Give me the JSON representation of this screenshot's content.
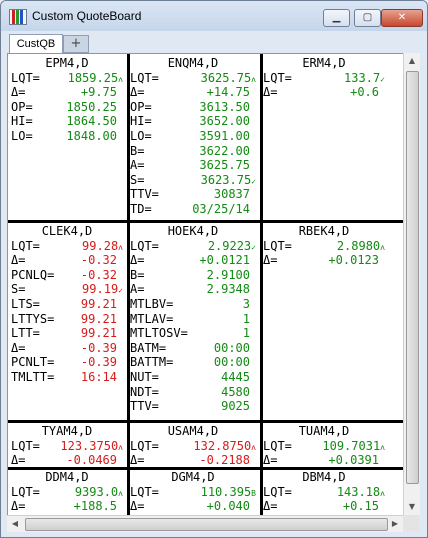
{
  "window": {
    "title": "Custom QuoteBoard",
    "minimize_glyph": "▁",
    "maximize_glyph": "▢",
    "close_glyph": "✕",
    "app_icon_colors": [
      "#cc2222",
      "#2a9a2a",
      "#2255cc"
    ]
  },
  "tabs": [
    {
      "label": "CustQB",
      "active": true
    }
  ],
  "add_tab_label": "+",
  "colors": {
    "up": "#138a13",
    "down": "#d81a1a",
    "grid": "#000000",
    "background": "#ffffff"
  },
  "icons": {
    "scroll_up": "▲",
    "scroll_down": "▼",
    "scroll_left": "◀",
    "scroll_right": "▶"
  },
  "quotes": [
    {
      "symbol": "EPM4,D",
      "rows": [
        {
          "label": "LQT=",
          "value": "1859.25",
          "color": "up",
          "mark": "ʌ"
        },
        {
          "label": "Δ=",
          "value": "+9.75",
          "color": "up"
        },
        {
          "label": "OP=",
          "value": "1850.25",
          "color": "up"
        },
        {
          "label": "HI=",
          "value": "1864.50",
          "color": "up"
        },
        {
          "label": "LO=",
          "value": "1848.00",
          "color": "up"
        }
      ]
    },
    {
      "symbol": "ENQM4,D",
      "rows": [
        {
          "label": "LQT=",
          "value": "3625.75",
          "color": "up",
          "mark": "ʌ"
        },
        {
          "label": "Δ=",
          "value": "+14.75",
          "color": "up"
        },
        {
          "label": "OP=",
          "value": "3613.50",
          "color": "up"
        },
        {
          "label": "HI=",
          "value": "3652.00",
          "color": "up"
        },
        {
          "label": "LO=",
          "value": "3591.00",
          "color": "up"
        },
        {
          "label": "B=",
          "value": "3622.00",
          "color": "up"
        },
        {
          "label": "A=",
          "value": "3625.75",
          "color": "up"
        },
        {
          "label": "S=",
          "value": "3623.75",
          "color": "up",
          "mark": "✓"
        },
        {
          "label": "TTV=",
          "value": "30837",
          "color": "up"
        },
        {
          "label": "TD=",
          "value": "03/25/14",
          "color": "up"
        }
      ]
    },
    {
      "symbol": "ERM4,D",
      "rows": [
        {
          "label": "LQT=",
          "value": "133.7",
          "color": "up",
          "mark": "✓"
        },
        {
          "label": "Δ=",
          "value": "+0.6",
          "color": "up"
        }
      ]
    },
    {
      "symbol": "CLEK4,D",
      "rows": [
        {
          "label": "LQT=",
          "value": "99.28",
          "color": "down",
          "mark": "ʌ"
        },
        {
          "label": "Δ=",
          "value": "-0.32",
          "color": "down"
        },
        {
          "label": "PCNLQ=",
          "value": "-0.32",
          "color": "down"
        },
        {
          "label": "S=",
          "value": "99.19",
          "color": "down",
          "mark": "✓"
        },
        {
          "label": "LTS=",
          "value": "99.21",
          "color": "down"
        },
        {
          "label": "LTTYS=",
          "value": "99.21",
          "color": "down"
        },
        {
          "label": "LTT=",
          "value": "99.21",
          "color": "down"
        },
        {
          "label": "Δ=",
          "value": "-0.39",
          "color": "down"
        },
        {
          "label": "PCNLT=",
          "value": "-0.39",
          "color": "down"
        },
        {
          "label": "TMLTT=",
          "value": "16:14",
          "color": "down"
        }
      ]
    },
    {
      "symbol": "HOEK4,D",
      "rows": [
        {
          "label": "LQT=",
          "value": "2.9223",
          "color": "up",
          "mark": "✓"
        },
        {
          "label": "Δ=",
          "value": "+0.0121",
          "color": "up"
        },
        {
          "label": "B=",
          "value": "2.9100",
          "color": "up"
        },
        {
          "label": "A=",
          "value": "2.9348",
          "color": "up"
        },
        {
          "label": "MTLBV=",
          "value": "3",
          "color": "up"
        },
        {
          "label": "MTLAV=",
          "value": "1",
          "color": "up"
        },
        {
          "label": "MTLTOSV=",
          "value": "1",
          "color": "up"
        },
        {
          "label": "BATM=",
          "value": "00:00",
          "color": "up"
        },
        {
          "label": "BATTM=",
          "value": "00:00",
          "color": "up"
        },
        {
          "label": "NUT=",
          "value": "4445",
          "color": "up"
        },
        {
          "label": "NDT=",
          "value": "4580",
          "color": "up"
        },
        {
          "label": "TTV=",
          "value": "9025",
          "color": "up"
        }
      ]
    },
    {
      "symbol": "RBEK4,D",
      "rows": [
        {
          "label": "LQT=",
          "value": "2.8980",
          "color": "up",
          "mark": "ʌ"
        },
        {
          "label": "Δ=",
          "value": "+0.0123",
          "color": "up"
        }
      ]
    },
    {
      "symbol": "TYAM4,D",
      "rows": [
        {
          "label": "LQT=",
          "value": "123.3750",
          "color": "down",
          "mark": "ʌ"
        },
        {
          "label": "Δ=",
          "value": "-0.0469",
          "color": "down"
        }
      ]
    },
    {
      "symbol": "USAM4,D",
      "rows": [
        {
          "label": "LQT=",
          "value": "132.8750",
          "color": "down",
          "mark": "ʌ"
        },
        {
          "label": "Δ=",
          "value": "-0.2188",
          "color": "down"
        }
      ]
    },
    {
      "symbol": "TUAM4,D",
      "rows": [
        {
          "label": "LQT=",
          "value": "109.7031",
          "color": "up",
          "mark": "ʌ"
        },
        {
          "label": "Δ=",
          "value": "+0.0391",
          "color": "up"
        }
      ]
    },
    {
      "symbol": "DDM4,D",
      "rows": [
        {
          "label": "LQT=",
          "value": "9393.0",
          "color": "up",
          "mark": "ʌ"
        },
        {
          "label": "Δ=",
          "value": "+188.5",
          "color": "up"
        }
      ]
    },
    {
      "symbol": "DGM4,D",
      "rows": [
        {
          "label": "LQT=",
          "value": "110.395",
          "color": "up",
          "mark": "B"
        },
        {
          "label": "Δ=",
          "value": "+0.040",
          "color": "up"
        }
      ]
    },
    {
      "symbol": "DBM4,D",
      "rows": [
        {
          "label": "LQT=",
          "value": "143.18",
          "color": "up",
          "mark": "ʌ"
        },
        {
          "label": "Δ=",
          "value": "+0.15",
          "color": "up"
        }
      ]
    }
  ]
}
